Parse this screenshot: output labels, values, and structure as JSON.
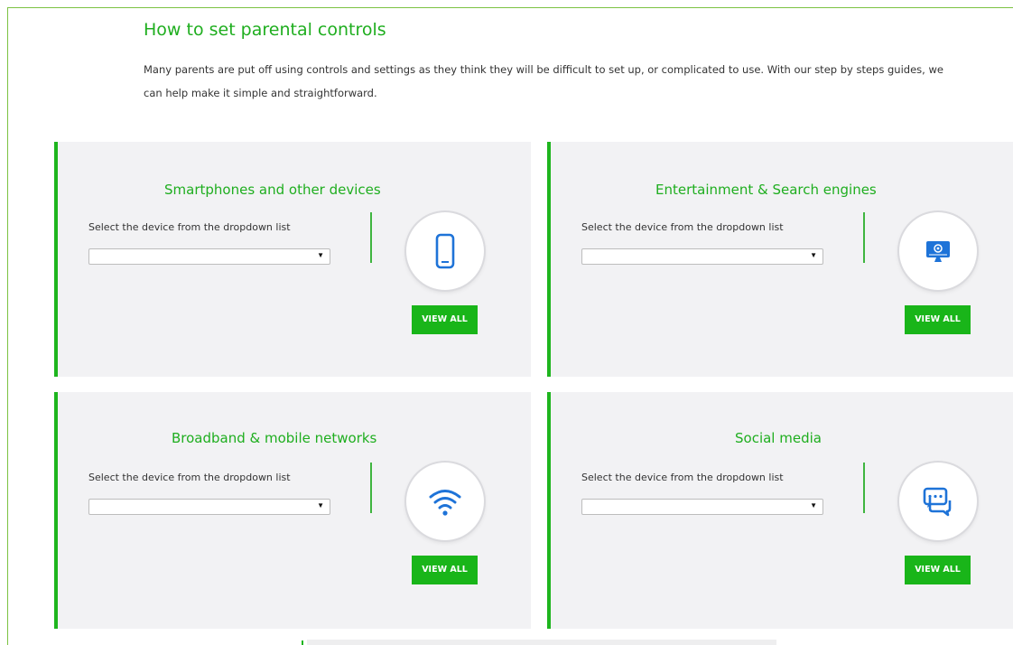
{
  "page": {
    "title": "How to set parental controls",
    "intro": "Many parents are put off using controls and settings as they think they will be difficult to set up, or complicated to use. With our step by steps guides, we can help make it simple and straightforward."
  },
  "colors": {
    "accent": "#1fae1f",
    "button": "#19b519",
    "card_bg": "#f2f2f4",
    "icon": "#1e73d8"
  },
  "cards": [
    {
      "title": "Smartphones and other devices",
      "select_label": "Select the device from the dropdown list",
      "select_value": "",
      "button_label": "VIEW ALL",
      "icon": "smartphone-icon"
    },
    {
      "title": "Entertainment & Search engines",
      "select_label": "Select the device from the dropdown list",
      "select_value": "",
      "button_label": "VIEW ALL",
      "icon": "monitor-icon"
    },
    {
      "title": "Broadband & mobile networks",
      "select_label": "Select the device from the dropdown list",
      "select_value": "",
      "button_label": "VIEW ALL",
      "icon": "wifi-icon"
    },
    {
      "title": "Social media",
      "select_label": "Select the device from the dropdown list",
      "select_value": "",
      "button_label": "VIEW ALL",
      "icon": "chat-bubbles-icon"
    }
  ]
}
